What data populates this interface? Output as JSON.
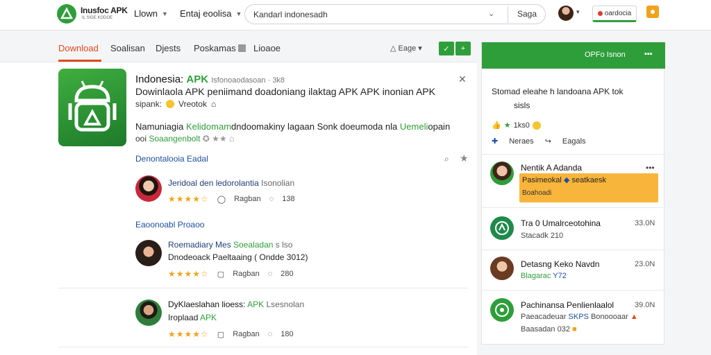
{
  "header": {
    "logo_text": "Inusfoc APK",
    "logo_sub": "IL SIGE KODOE",
    "nav1": "Llown",
    "nav2": "Entaj eoolisa",
    "search_value": "Kandarl indonesadh",
    "search_button": "Saga",
    "brand_label": "oardocia"
  },
  "subnav": {
    "tabs": [
      "Download",
      "Soalisan",
      "Djests",
      "Poskamas",
      "Lioaoe"
    ],
    "age_label": "Eage",
    "accent": "#2e9e3a",
    "active_color": "#e04a1a"
  },
  "app": {
    "title_prefix": "Indonesia:",
    "title_accent": "APK",
    "title_meta": "Isfonoaodasoan · 3k8",
    "desc1": "Dowinlaola APK peniimand doadoniang ilaktag APK APK inonian APK",
    "desc2": "sipank:",
    "desc2b": "Vreotok",
    "desc3a": "Namuniagia",
    "desc3b": "Kelidomam",
    "desc3c": "dndoomakiny lagaan Sonk doeumoda nla",
    "desc3d": "Uemeli",
    "desc3e": "opain",
    "desc4a": "ooi",
    "desc4b": "Soaangenbolt",
    "section_link": "Denontalooia Eadal"
  },
  "reviews": [
    {
      "name": "Jeridoal den ledorolantia",
      "meta": "Isonolian",
      "line2": "",
      "stars": "★★★★☆",
      "tag": "Ragban",
      "count": "138"
    },
    {
      "name": "Roemadiary Mes",
      "name_green": "Soealadan",
      "meta": "s lso",
      "line2": "Dnodeoack Paeltaaing ( Ondde 3012)",
      "stars": "★★★★☆",
      "tag": "Ragban",
      "count": "280"
    },
    {
      "name": "DyKlaeslahan lioess:",
      "name_green": "APK",
      "meta": "Lsesnolan",
      "line2": "Iroplaad",
      "line2_green": "APK",
      "stars": "★★★★☆",
      "tag": "Ragban",
      "count": "180"
    }
  ],
  "section2": "Eaoonoabl Proaoo",
  "panel": {
    "header_label": "OPFo Isnon",
    "header_more": "▪▪▪",
    "desc": "Stomad eleahe h landoana APK tok",
    "desc2": "sisls",
    "likes": "1ks0",
    "action1": "Neraes",
    "action2": "Eagals",
    "feed": [
      {
        "name": "Nentik A Adanda",
        "time": "",
        "sub": "Pasimeokal",
        "sub_b": "seatkaesk",
        "sub2": "Boahoadi",
        "highlight": true
      },
      {
        "name": "Tra 0 Umalrceotohina",
        "time": "33.0N",
        "sub": "Stacadk",
        "sub2": "210"
      },
      {
        "name": "Detasng Keko Navdn",
        "time": "23.0N",
        "sub": "Blagarac",
        "sub2": "Y72"
      },
      {
        "name": "Pachinansa Penlienlaalol",
        "time": "39.0N",
        "sub": "Paeacadeuar",
        "sub_b": "SKPS",
        "sub3": "Bonoooaar",
        "sub4": "Baasadan 032"
      }
    ]
  }
}
